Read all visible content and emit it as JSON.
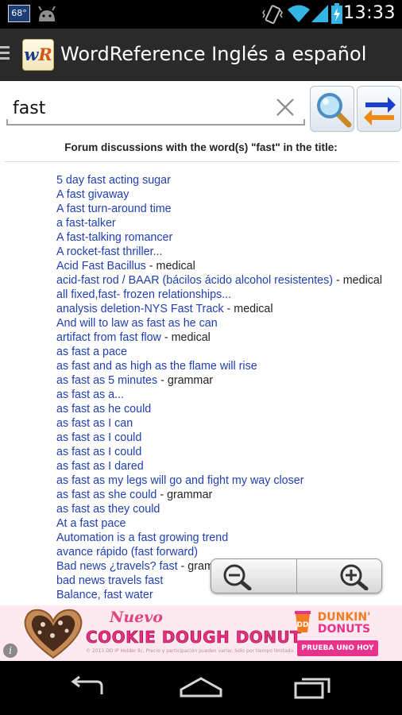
{
  "status_bar": {
    "temperature": "68°",
    "time": "13:33",
    "icons": [
      "android-icon",
      "vibrate-icon",
      "wifi-icon",
      "signal-icon",
      "battery-charging-icon"
    ]
  },
  "app_bar": {
    "logo_w": "w",
    "logo_r": "R",
    "title": "WordReference Inglés a español"
  },
  "search": {
    "value": "fast",
    "placeholder": ""
  },
  "forum": {
    "heading": "Forum discussions with the word(s) \"fast\" in the title:",
    "results": [
      {
        "title": "5 day fast acting sugar",
        "category": ""
      },
      {
        "title": "A fast givaway",
        "category": ""
      },
      {
        "title": "A fast turn-around time",
        "category": ""
      },
      {
        "title": "a fast-talker",
        "category": ""
      },
      {
        "title": "A fast-talking romancer",
        "category": ""
      },
      {
        "title": "A rocket-fast thriller...",
        "category": ""
      },
      {
        "title": "Acid Fast Bacillus",
        "category": " - medical"
      },
      {
        "title": "acid-fast rod / BAAR (bácilos ácido alcohol resistentes)",
        "category": " - medical"
      },
      {
        "title": "all fixed,fast- frozen relationships...",
        "category": ""
      },
      {
        "title": "analysis deletion-NYS Fast Track",
        "category": " - medical"
      },
      {
        "title": "And will to law as fast as he can",
        "category": ""
      },
      {
        "title": "artifact from fast flow",
        "category": " - medical"
      },
      {
        "title": "as fast a pace",
        "category": ""
      },
      {
        "title": "as fast and as high as the flame will rise",
        "category": ""
      },
      {
        "title": "as fast as 5 minutes",
        "category": " - grammar"
      },
      {
        "title": "as fast as a...",
        "category": ""
      },
      {
        "title": "as fast as he could",
        "category": ""
      },
      {
        "title": "as fast as I can",
        "category": ""
      },
      {
        "title": "as fast as I could",
        "category": ""
      },
      {
        "title": "as fast as I could",
        "category": ""
      },
      {
        "title": "as fast as I dared",
        "category": ""
      },
      {
        "title": "as fast as my legs will go and fight my way closer",
        "category": ""
      },
      {
        "title": "as fast as she could",
        "category": " - grammar"
      },
      {
        "title": "as fast as they could",
        "category": ""
      },
      {
        "title": "At a fast pace",
        "category": ""
      },
      {
        "title": "Automation is a fast growing trend",
        "category": ""
      },
      {
        "title": "avance rápido (fast forward)",
        "category": ""
      },
      {
        "title": "Bad news ¿travels? fast",
        "category": " - gram"
      },
      {
        "title": "bad news travels fast",
        "category": ""
      },
      {
        "title": "Balance, fast water",
        "category": ""
      }
    ]
  },
  "zoom": {
    "out_icon": "zoom-out-icon",
    "in_icon": "zoom-in-icon"
  },
  "ad": {
    "info": "i",
    "nuevo": "Nuevo",
    "headline": "COOKIE DOUGH DONUT",
    "fine_print": "© 2013 DD IP Holder llc. Precio y participación pueden variar. Sólo por tiempo limitado.",
    "brand_line1": "DUNKIN'",
    "brand_line2": "DONUTS",
    "cta": "PRUEBA UNO HOY"
  },
  "nav_bar": {
    "icons": [
      "back-icon",
      "home-icon",
      "recent-apps-icon"
    ]
  },
  "colors": {
    "link": "#1f3fb3",
    "app_bar": "#2a2a2a",
    "status_bar": "#000000",
    "ad_pink": "#ec2d86",
    "status_icon_blue": "#33b5e5"
  }
}
